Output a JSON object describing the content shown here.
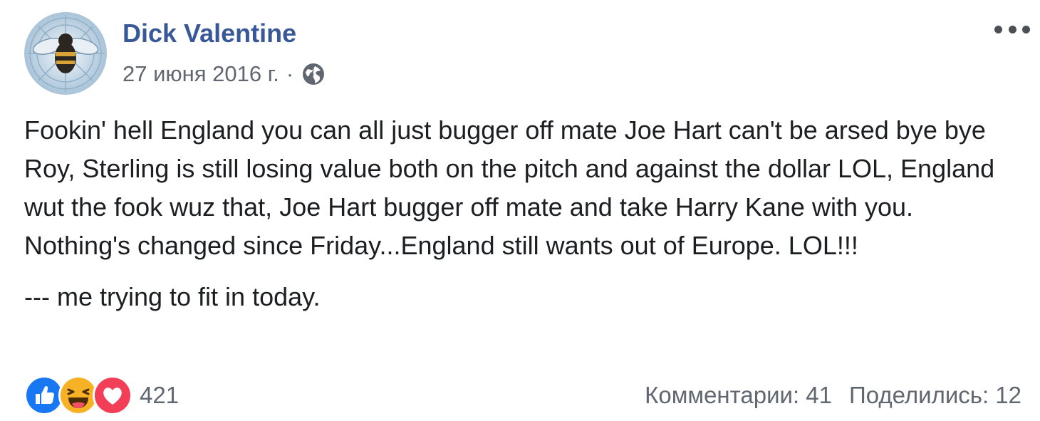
{
  "post": {
    "author": "Dick Valentine",
    "date": "27 июня 2016 г.",
    "separator": "·",
    "privacy_icon": "globe-icon",
    "paragraphs": [
      "Fookin' hell England you can all just bugger off mate Joe Hart can't be arsed bye bye Roy, Sterling is still losing value both on the pitch and against the dollar LOL, England wut the fook wuz that, Joe Hart bugger off mate and take Harry Kane with you. Nothing's changed since Friday...England still wants out of Europe. LOL!!!",
      "--- me trying to fit in today."
    ]
  },
  "reactions": {
    "icons": [
      "like-icon",
      "haha-icon",
      "love-icon"
    ],
    "count": "421"
  },
  "stats": {
    "comments": "Комментарии: 41",
    "shares": "Поделились: 12"
  },
  "colors": {
    "author_link": "#385898",
    "meta_text": "#606770",
    "like": "#1877f2",
    "haha": "#f7b125",
    "love": "#f33e58"
  }
}
